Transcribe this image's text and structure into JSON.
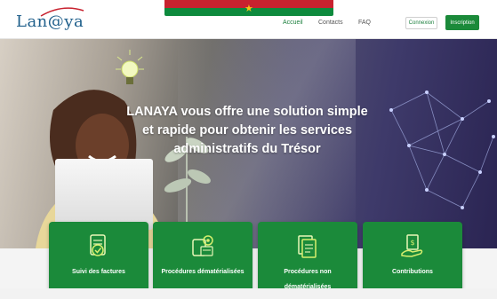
{
  "header": {
    "logo_text": "Lan@ya",
    "nav": [
      {
        "label": "Accueil",
        "active": true
      },
      {
        "label": "Contacts",
        "active": false
      },
      {
        "label": "FAQ",
        "active": false
      }
    ],
    "login_label": "Connexion",
    "signup_label": "Inscription"
  },
  "hero": {
    "tagline_line1": "LANAYA vous offre une solution simple",
    "tagline_line2": "et rapide pour obtenir les services",
    "tagline_line3": "administratifs du Trésor"
  },
  "cards": [
    {
      "label": "Suivi des factures",
      "icon": "invoice-tracking-icon"
    },
    {
      "label": "Procédures dématérialisées",
      "icon": "digital-procedures-icon"
    },
    {
      "label": "Procédures non dématérialisées",
      "icon": "paper-procedures-icon"
    },
    {
      "label": "Contributions",
      "icon": "contributions-icon"
    }
  ],
  "colors": {
    "brand_green": "#1b8a3a",
    "logo_blue": "#1f5f8b",
    "flag_red": "#c8222f",
    "flag_green": "#0d8a3d",
    "flag_star": "#f5c518"
  }
}
